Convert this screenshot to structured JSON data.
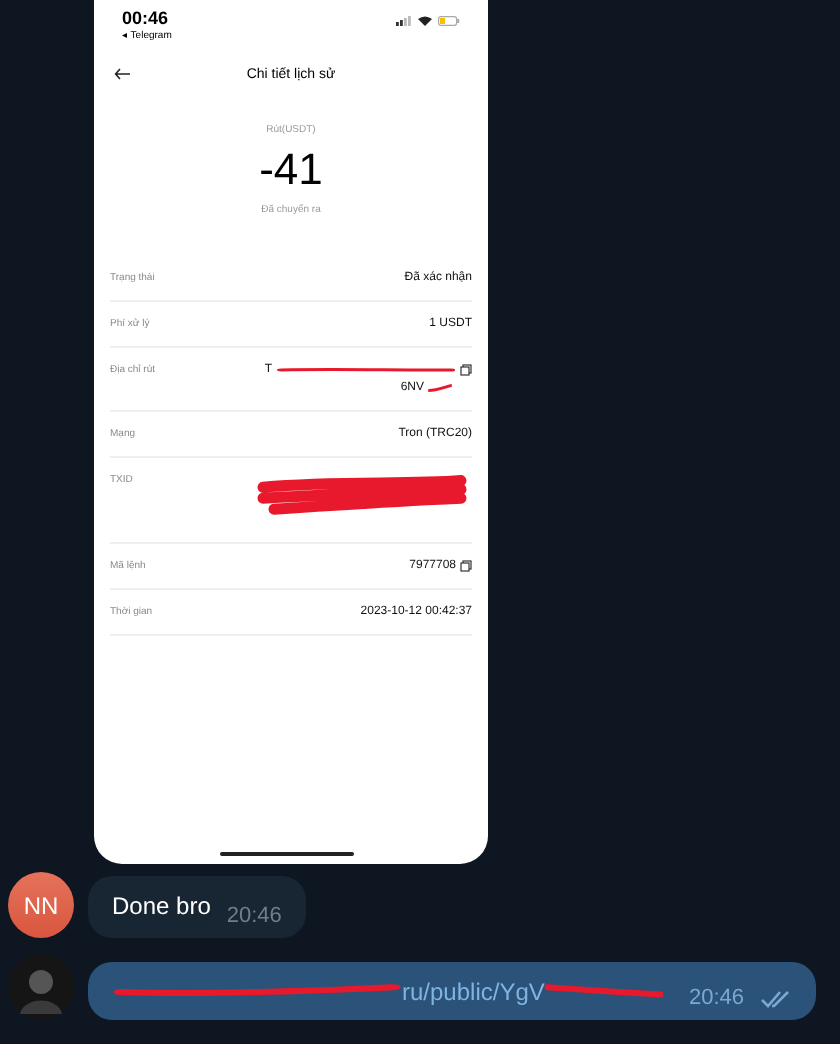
{
  "status_bar": {
    "time": "00:46",
    "back_app": "◂ Telegram"
  },
  "header": {
    "title": "Chi tiết lịch sử"
  },
  "summary": {
    "label": "Rút(USDT)",
    "amount": "-41",
    "status": "Đã chuyển ra"
  },
  "details": [
    {
      "label": "Trạng thái",
      "value_lines": [
        "Đã xác nhận"
      ],
      "copyable": false,
      "redacted": false
    },
    {
      "label": "Phí xử lý",
      "value_lines": [
        "1 USDT"
      ],
      "copyable": false,
      "redacted": false
    },
    {
      "label": "Địa chỉ rút",
      "value_lines": [
        "T",
        "6NV"
      ],
      "copyable": true,
      "redacted": true
    },
    {
      "label": "Mạng",
      "value_lines": [
        "Tron (TRC20)"
      ],
      "copyable": false,
      "redacted": false
    },
    {
      "label": "TXID",
      "copyable": false,
      "redacted": true
    },
    {
      "label": "Mã lệnh",
      "value_lines": [
        "7977708"
      ],
      "copyable": true,
      "redacted": false
    },
    {
      "label": "Thời gian",
      "value_lines": [
        "2023-10-12 00:42:37"
      ],
      "copyable": false,
      "redacted": false
    }
  ],
  "messages": [
    {
      "kind": "incoming",
      "avatar_initials": "NN",
      "text": "Done bro",
      "time": "20:46"
    },
    {
      "kind": "outgoing",
      "text": "ru/public/YgV",
      "time": "20:46",
      "redacted": true,
      "read": true
    }
  ]
}
